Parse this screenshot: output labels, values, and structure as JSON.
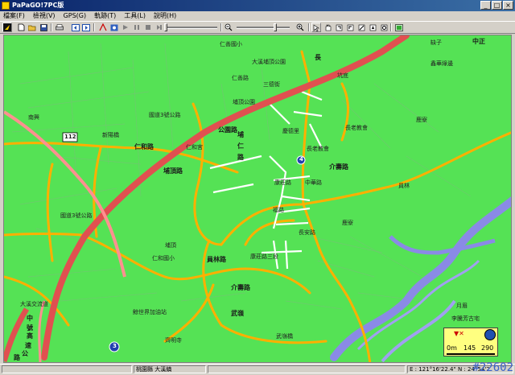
{
  "window": {
    "title": "PaPaGO!7PC版"
  },
  "menu": [
    "檔案(F)",
    "檢視(V)",
    "GPS(G)",
    "軌跡(T)",
    "工具(L)",
    "說明(H)"
  ],
  "map": {
    "labels": {
      "c1": "仁善國小",
      "c2": "大溪埔頂公園",
      "c3": "長",
      "c4": "仁善路",
      "c5": "三德街",
      "c6": "埔頂公園",
      "c7": "坑底",
      "c8": "中正",
      "c9": "鹿寮",
      "c10": "南興",
      "c11": "新陽橋",
      "c12": "國道3號公路",
      "c13": "仁和宮",
      "c14": "長老教會",
      "c15": "長老教會",
      "c16": "員林",
      "c17": "國道3號公路",
      "c18": "埔頂",
      "c19": "仁和國小",
      "c20": "長安路",
      "c21": "康莊路三段",
      "c22": "大溪交流道",
      "c23": "中",
      "c24": "號",
      "c25": "高",
      "c26": "速",
      "c27": "公",
      "c28": "路",
      "c29": "鯨世界加油站",
      "c30": "齊明寺",
      "c31": "武嶺橋",
      "c32": "月眉",
      "c33": "李騰芳古宅",
      "c34": "埔",
      "c35": "仁",
      "c36": "路",
      "c37": "仁和路",
      "c38": "埔頂路",
      "c39": "員林路",
      "c40": "介壽路",
      "c41": "福路",
      "c42": "康莊路",
      "c43": "慶德里",
      "c44": "中華路",
      "c45": "介壽路",
      "c46": "公園路",
      "c47": "武嶺",
      "c48": "鹿寮",
      "c49": "缺子",
      "c50": "鑫華綠邊"
    },
    "shields": {
      "s1": "112",
      "s2": "3",
      "s3": "4"
    },
    "scale": {
      "unit": "0m",
      "v1": "145",
      "v2": "290"
    }
  },
  "status": {
    "pane1": "",
    "pane2": "桃園縣 大溪鎮",
    "pane3": "",
    "coord": "E : 121°16'22.4\"  N : 24°54'2",
    "watermark": "#22602"
  }
}
